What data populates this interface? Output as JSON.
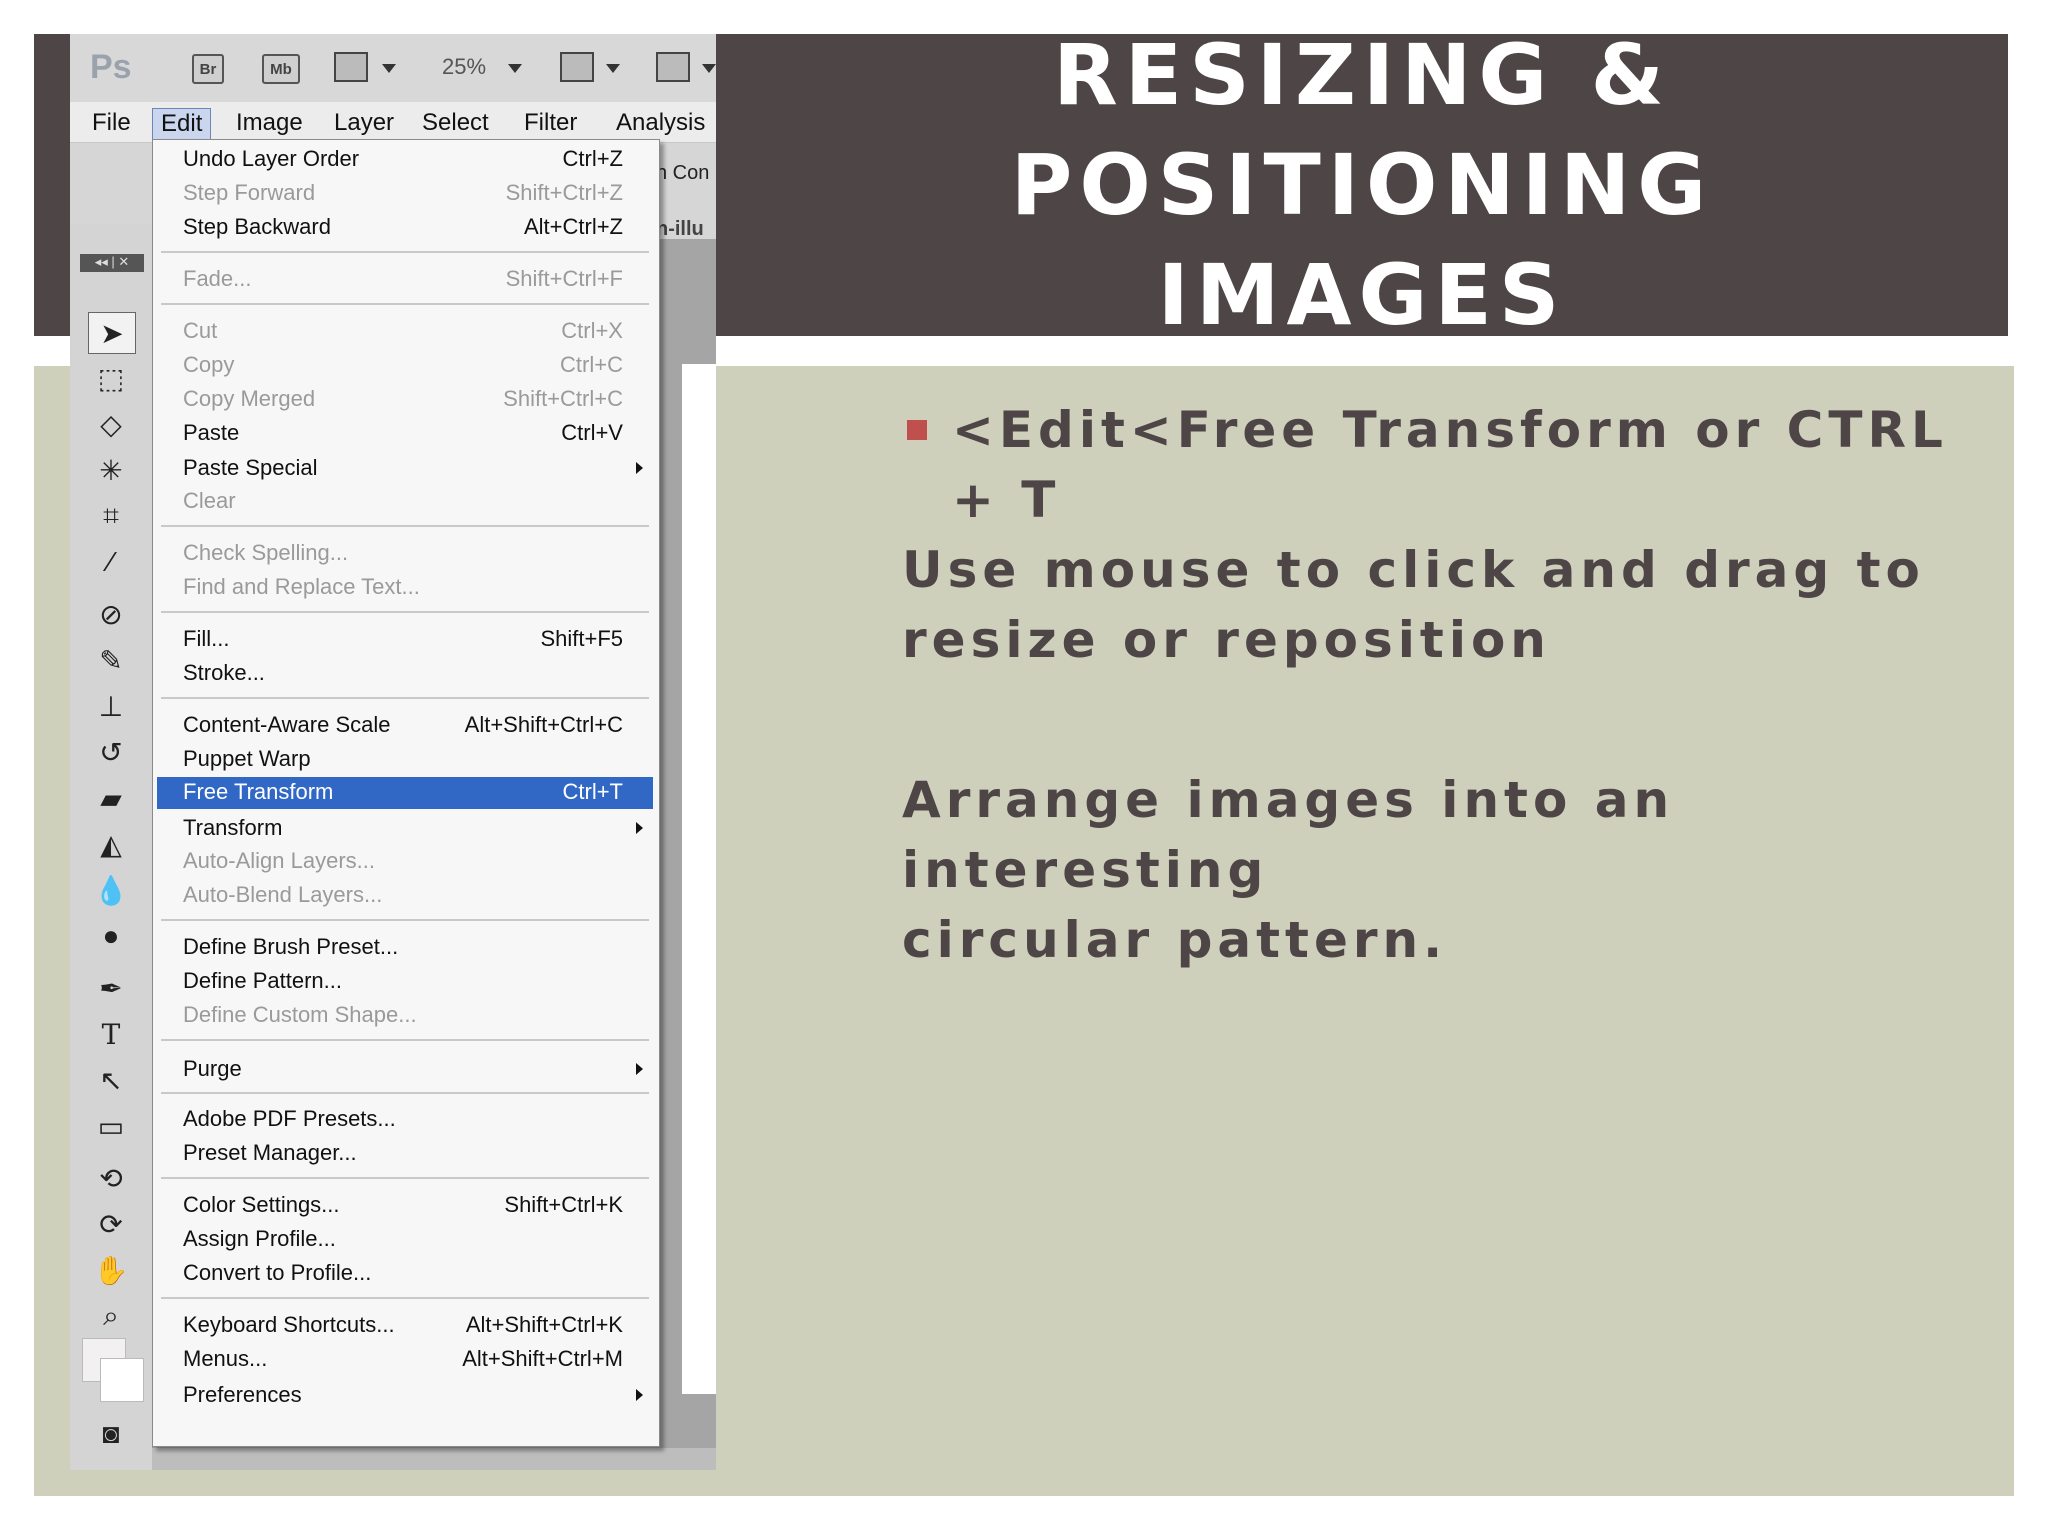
{
  "slide": {
    "title_line1": "RESIZING & POSITIONING",
    "title_line2": "IMAGES",
    "bullet": "<Edit<Free Transform or CTRL + T",
    "para1_line1": "Use mouse to click and drag to",
    "para1_line2": "resize or reposition",
    "para2_line1": "Arrange images into an interesting",
    "para2_line2": "circular pattern.",
    "colors": {
      "title_band": "#4e4546",
      "body_band": "#cfd0bc",
      "bullet": "#c0504d",
      "text": "#4e4546"
    }
  },
  "app": {
    "logo": "Ps",
    "bridge_label": "Br",
    "minibridge_label": "Mb",
    "zoom": "25%",
    "menubar": [
      "File",
      "Edit",
      "Image",
      "Layer",
      "Select",
      "Filter",
      "Analysis"
    ],
    "active_menu": "Edit",
    "options_fragment": "n Con",
    "doc_tab_fragment": "n-illu",
    "selection_color": "#3168c6"
  },
  "edit_menu": {
    "items": [
      {
        "label": "Undo Layer Order",
        "shortcut": "Ctrl+Z"
      },
      {
        "label": "Step Forward",
        "shortcut": "Shift+Ctrl+Z"
      },
      {
        "label": "Step Backward",
        "shortcut": "Alt+Ctrl+Z"
      },
      {
        "label": "Fade...",
        "shortcut": "Shift+Ctrl+F"
      },
      {
        "label": "Cut",
        "shortcut": "Ctrl+X"
      },
      {
        "label": "Copy",
        "shortcut": "Ctrl+C"
      },
      {
        "label": "Copy Merged",
        "shortcut": "Shift+Ctrl+C"
      },
      {
        "label": "Paste",
        "shortcut": "Ctrl+V"
      },
      {
        "label": "Paste Special",
        "shortcut": ""
      },
      {
        "label": "Clear",
        "shortcut": ""
      },
      {
        "label": "Check Spelling...",
        "shortcut": ""
      },
      {
        "label": "Find and Replace Text...",
        "shortcut": ""
      },
      {
        "label": "Fill...",
        "shortcut": "Shift+F5"
      },
      {
        "label": "Stroke...",
        "shortcut": ""
      },
      {
        "label": "Content-Aware Scale",
        "shortcut": "Alt+Shift+Ctrl+C"
      },
      {
        "label": "Puppet Warp",
        "shortcut": ""
      },
      {
        "label": "Free Transform",
        "shortcut": "Ctrl+T"
      },
      {
        "label": "Transform",
        "shortcut": ""
      },
      {
        "label": "Auto-Align Layers...",
        "shortcut": ""
      },
      {
        "label": "Auto-Blend Layers...",
        "shortcut": ""
      },
      {
        "label": "Define Brush Preset...",
        "shortcut": ""
      },
      {
        "label": "Define Pattern...",
        "shortcut": ""
      },
      {
        "label": "Define Custom Shape...",
        "shortcut": ""
      },
      {
        "label": "Purge",
        "shortcut": ""
      },
      {
        "label": "Adobe PDF Presets...",
        "shortcut": ""
      },
      {
        "label": "Preset Manager...",
        "shortcut": ""
      },
      {
        "label": "Color Settings...",
        "shortcut": "Shift+Ctrl+K"
      },
      {
        "label": "Assign Profile...",
        "shortcut": ""
      },
      {
        "label": "Convert to Profile...",
        "shortcut": ""
      },
      {
        "label": "Keyboard Shortcuts...",
        "shortcut": "Alt+Shift+Ctrl+K"
      },
      {
        "label": "Menus...",
        "shortcut": "Alt+Shift+Ctrl+M"
      },
      {
        "label": "Preferences",
        "shortcut": ""
      }
    ]
  },
  "toolbox": {
    "tools": [
      "move-tool",
      "marquee-tool",
      "lasso-tool",
      "magic-wand-tool",
      "crop-tool",
      "eyedropper-tool",
      "healing-brush-tool",
      "brush-tool",
      "clone-stamp-tool",
      "history-brush-tool",
      "eraser-tool",
      "paint-bucket-tool",
      "blur-tool",
      "dodge-tool",
      "pen-tool",
      "type-tool",
      "path-selection-tool",
      "rectangle-tool",
      "3d-rotate-tool",
      "3d-orbit-tool",
      "hand-tool",
      "zoom-tool"
    ]
  }
}
